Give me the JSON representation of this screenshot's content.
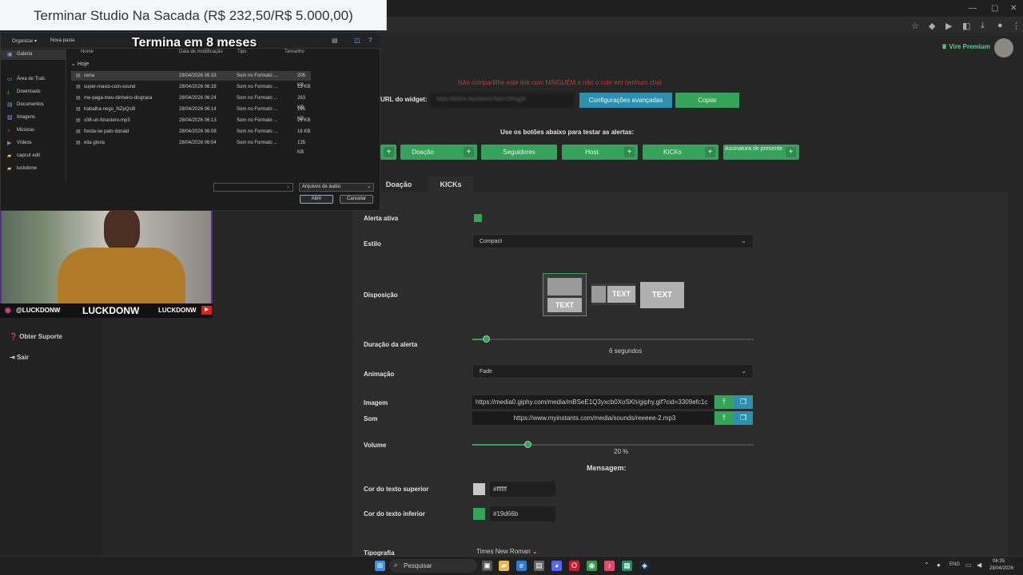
{
  "goal": {
    "text": "Terminar Studio Na Sacada (R$ 232,50/R$ 5.000,00)"
  },
  "countdown": "Termina em 8 meses",
  "dialog": {
    "toolbar": {
      "organize": "Organizar ▾",
      "new_folder": "Nova pasta"
    },
    "sidebar": [
      "Galeria",
      "Área de Trab.",
      "Downloads",
      "Documentos",
      "Imagens",
      "Músicas",
      "Vídeos",
      "capcut edit",
      "luckdonw"
    ],
    "columns": {
      "name": "Nome",
      "date": "Data de modificação",
      "type": "Tipo",
      "size": "Tamanho"
    },
    "group": "Hoje",
    "files": [
      {
        "name": "cena",
        "date": "28/04/2026 06:33",
        "type": "Som no Formato ...",
        "size": "206 KB"
      },
      {
        "name": "super-maxio-coin-sound",
        "date": "28/04/2026 06:28",
        "type": "Som no Formato ...",
        "size": "13 KB"
      },
      {
        "name": "me-paga-meu-dinheiro-disgraca",
        "date": "28/04/2026 06:24",
        "type": "Som no Formato ...",
        "size": "263 KB"
      },
      {
        "name": "trabalha-nego_NZpQsI9",
        "date": "28/04/2026 06:14",
        "type": "Som no Formato ...",
        "size": "195 KB"
      },
      {
        "name": "x38-un-forastero-mp3",
        "date": "28/04/2026 06:13",
        "type": "Som no Formato ...",
        "size": "29 KB"
      },
      {
        "name": "fooda-se pato donald",
        "date": "28/04/2026 06:08",
        "type": "Som no Formato ...",
        "size": "16 KB"
      },
      {
        "name": "eita gloria",
        "date": "28/04/2026 06:04",
        "type": "Som no Formato ...",
        "size": "135 KB"
      }
    ],
    "filter": "Arquivos de áudio",
    "open": "Abrir",
    "cancel": "Cancelar"
  },
  "cam": {
    "instagram": "@LUCKDONW",
    "name": "LUCKDONW",
    "youtube": "LUCKDONW"
  },
  "browser": {
    "premium": "Vire Premium"
  },
  "sidebar": {
    "support": "Obter Suporte",
    "logout": "Sair"
  },
  "widget": {
    "warning": "Não compartilhe este link com NINGUÉM e não o cole em nenhum chat",
    "url_label": "URL do widget:",
    "url_value": "https://botrix.live/alerts?bid=1Wxg2k",
    "advanced": "Configurações avançadas",
    "copy": "Copiar",
    "test_hint": "Use os botões abaixo para testar as alertas:",
    "test_buttons": [
      "Doação",
      "Seguidores",
      "Host",
      "KICKs",
      "Assinatura de presente"
    ]
  },
  "tabs": [
    "Doação",
    "KICKs"
  ],
  "form": {
    "active_label": "Alerta ativa",
    "style_label": "Estilo",
    "style_value": "Compact",
    "layout_label": "Disposição",
    "layout_text": "TEXT",
    "duration_label": "Duração da alerta",
    "duration_value": "6 segundos",
    "duration_fraction": 0.05,
    "animation_label": "Animação",
    "animation_value": "Fade",
    "image_label": "Imagem",
    "image_value": "https://media0.giphy.com/media/mBSeE1Q3yxcb0XoSKh/giphy.gif?cid=3309efc1c",
    "sound_label": "Som",
    "sound_value": "https://www.myinstants.com/media/sounds/reeeee-2.mp3",
    "volume_label": "Volume",
    "volume_value": "20 %",
    "volume_fraction": 0.2,
    "message_label": "Mensagem:",
    "top_color_label": "Cor do texto superior",
    "top_color": "#ffffff",
    "bottom_color_label": "Cor do texto inferior",
    "bottom_color": "#19d66b",
    "font_label": "Tipografia",
    "font_value": "Times New Roman"
  },
  "taskbar": {
    "search": "Pesquisar",
    "lang": "ENG",
    "time": "06:35",
    "date": "28/04/2026"
  },
  "colors": {
    "accent": "#35a35a",
    "warning": "#c0393b"
  }
}
